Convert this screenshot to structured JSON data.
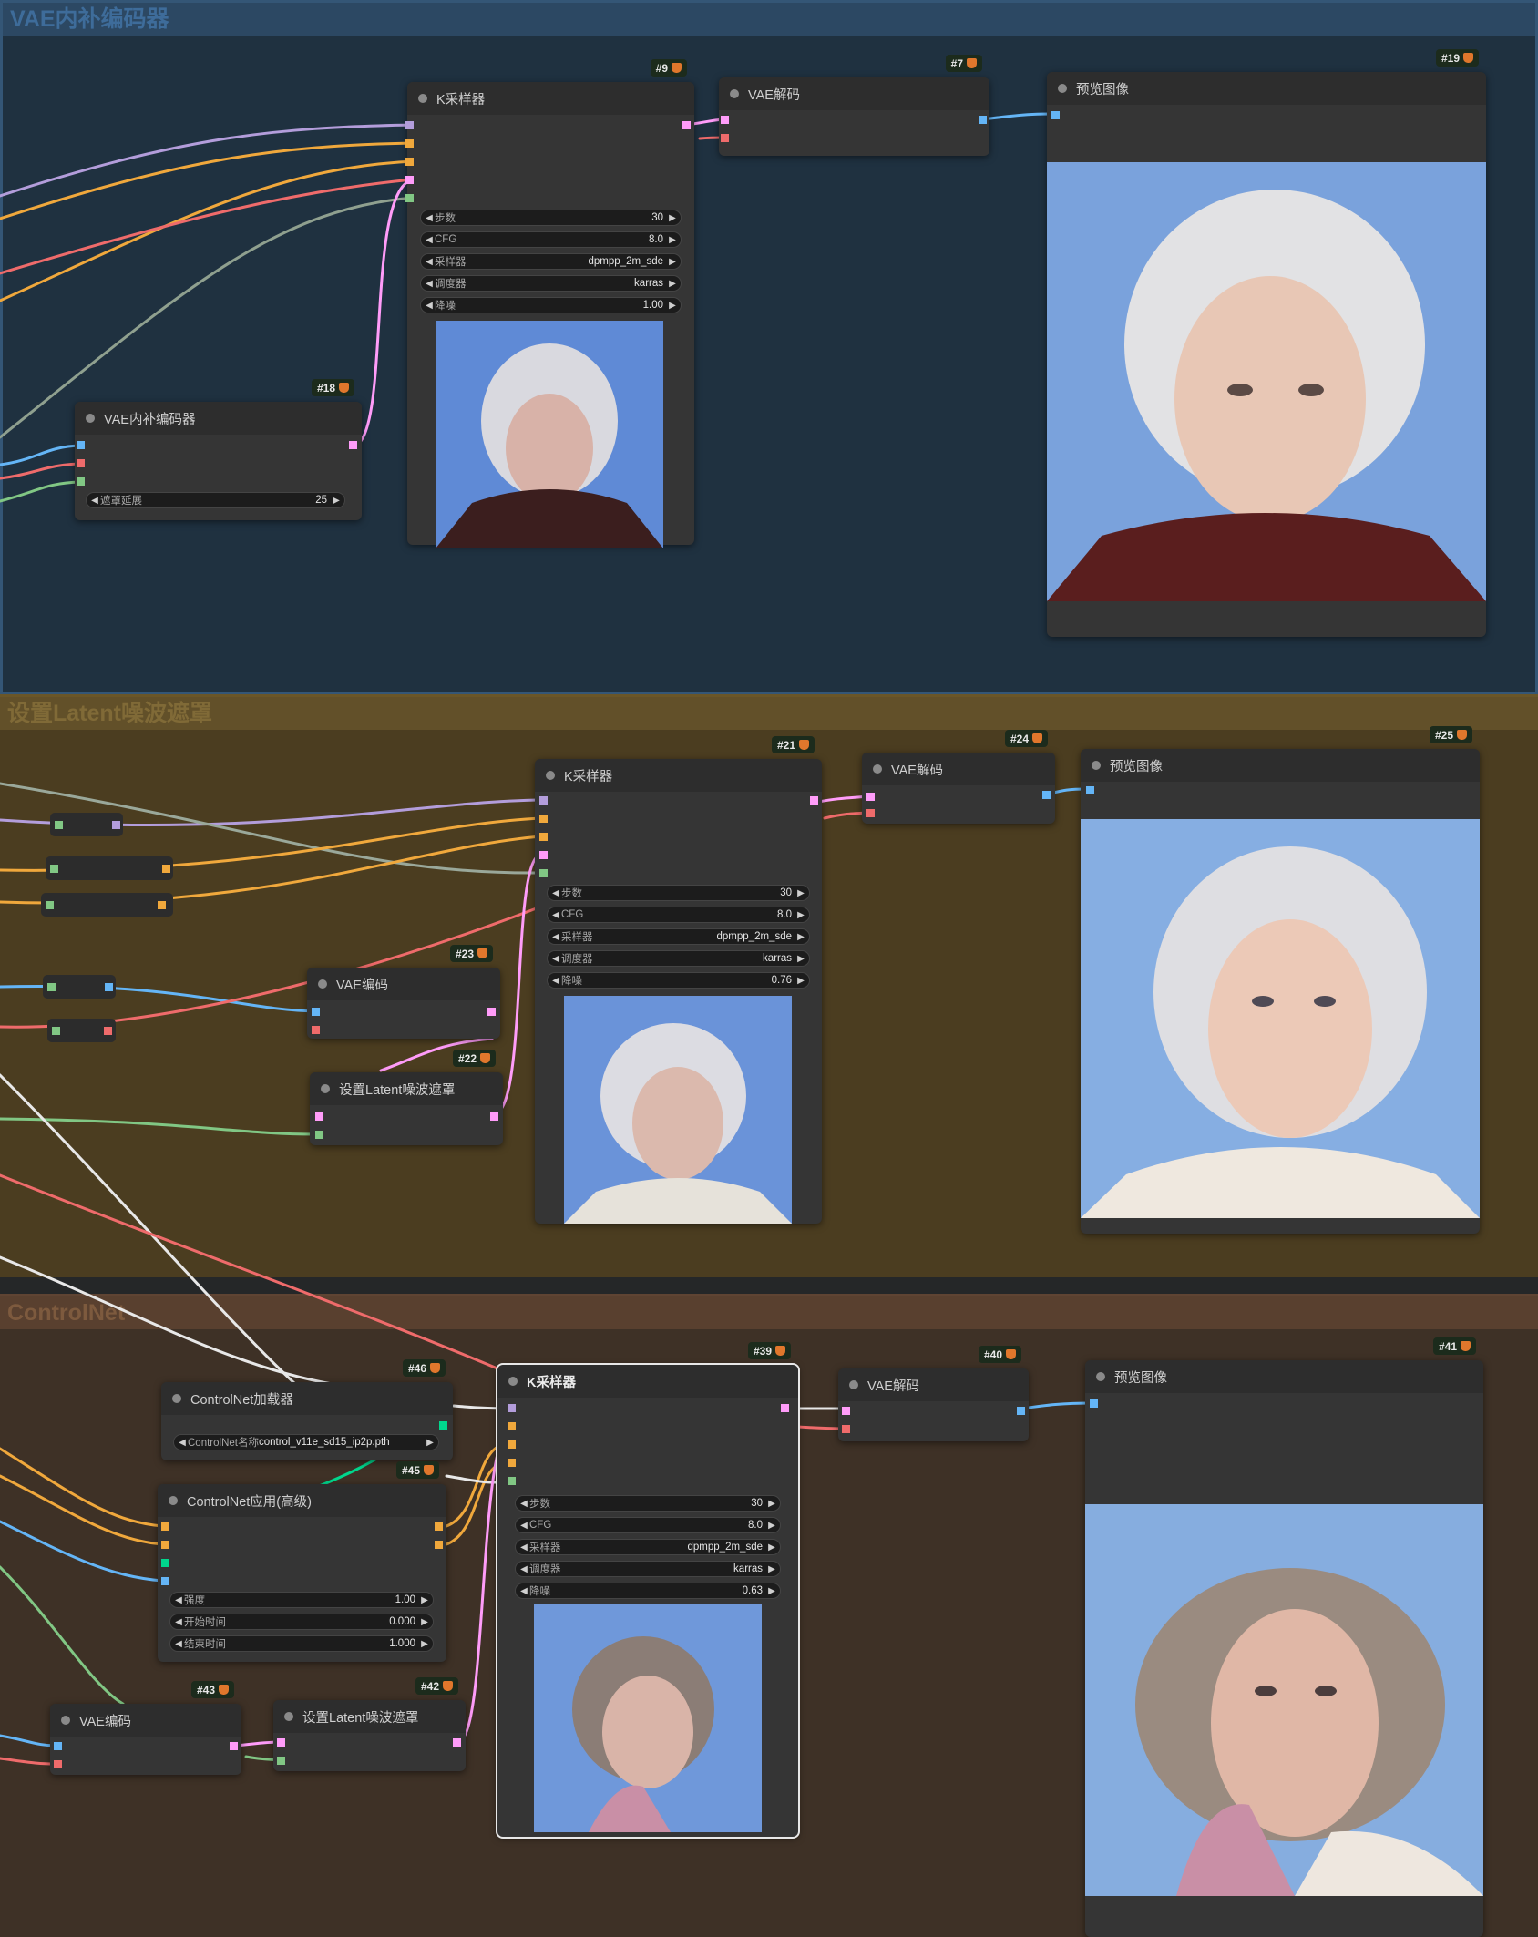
{
  "groups": {
    "g1_title": "VAE内补编码器",
    "g2_title": "设置Latent噪波遮罩",
    "g3_title": "ControlNet"
  },
  "nodes": {
    "n9": {
      "badge": "#9",
      "title": "K采样器",
      "steps_label": "步数",
      "steps": "30",
      "cfg_label": "CFG",
      "cfg": "8.0",
      "sampler_label": "采样器",
      "sampler": "dpmpp_2m_sde",
      "scheduler_label": "调度器",
      "scheduler": "karras",
      "denoise_label": "降噪",
      "denoise": "1.00"
    },
    "n7": {
      "badge": "#7",
      "title": "VAE解码"
    },
    "n19": {
      "badge": "#19",
      "title": "预览图像"
    },
    "n18": {
      "badge": "#18",
      "title": "VAE内补编码器",
      "grow_label": "遮罩延展",
      "grow": "25"
    },
    "n21": {
      "badge": "#21",
      "title": "K采样器",
      "steps_label": "步数",
      "steps": "30",
      "cfg_label": "CFG",
      "cfg": "8.0",
      "sampler_label": "采样器",
      "sampler": "dpmpp_2m_sde",
      "scheduler_label": "调度器",
      "scheduler": "karras",
      "denoise_label": "降噪",
      "denoise": "0.76"
    },
    "n24": {
      "badge": "#24",
      "title": "VAE解码"
    },
    "n25": {
      "badge": "#25",
      "title": "预览图像"
    },
    "n23": {
      "badge": "#23",
      "title": "VAE编码"
    },
    "n22": {
      "badge": "#22",
      "title": "设置Latent噪波遮罩"
    },
    "n46": {
      "badge": "#46",
      "title": "ControlNet加载器",
      "cn_label": "ControlNet名称",
      "cn_value": "control_v11e_sd15_ip2p.pth"
    },
    "n45": {
      "badge": "#45",
      "title": "ControlNet应用(高级)",
      "strength_label": "强度",
      "strength": "1.00",
      "start_label": "开始时间",
      "start": "0.000",
      "end_label": "结束时间",
      "end": "1.000"
    },
    "n39": {
      "badge": "#39",
      "title": "K采样器",
      "steps_label": "步数",
      "steps": "30",
      "cfg_label": "CFG",
      "cfg": "8.0",
      "sampler_label": "采样器",
      "sampler": "dpmpp_2m_sde",
      "scheduler_label": "调度器",
      "scheduler": "karras",
      "denoise_label": "降噪",
      "denoise": "0.63"
    },
    "n40": {
      "badge": "#40",
      "title": "VAE解码"
    },
    "n41": {
      "badge": "#41",
      "title": "预览图像"
    },
    "n43": {
      "badge": "#43",
      "title": "VAE编码"
    },
    "n42": {
      "badge": "#42",
      "title": "设置Latent噪波遮罩"
    }
  },
  "icons": {
    "badge_icon": "fox-icon",
    "widget_arrows": [
      "triangle-left-icon",
      "triangle-right-icon"
    ]
  },
  "colors": {
    "model": "#b39ddb",
    "clip": "#f0a83c",
    "conditioning": "#f0a83c",
    "latent": "#ff9cf9",
    "vae": "#ff6e6e",
    "image": "#64b5f6",
    "mask": "#81c784",
    "control_net": "#00d78d",
    "group1": "#2c4863",
    "group2": "#625029",
    "group3": "#59402f"
  }
}
